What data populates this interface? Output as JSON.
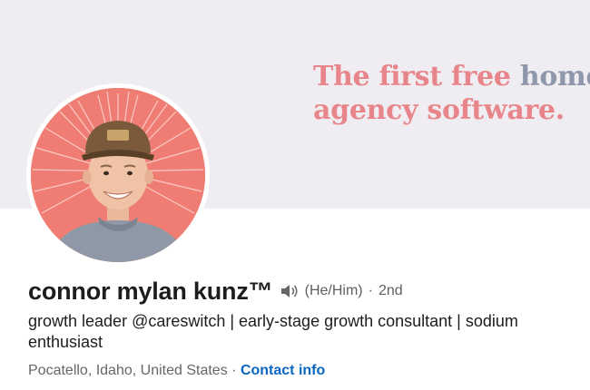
{
  "banner": {
    "line1_part1": "The first free",
    "line1_part2": "home c",
    "line2": "agency software."
  },
  "profile": {
    "name": "connor mylan kunz",
    "trademark": "™",
    "pronouns": "(He/Him)",
    "separator": "·",
    "degree": "2nd",
    "headline": "growth leader @careswitch | early-stage growth consultant | sodium enthusiast",
    "location": "Pocatello, Idaho, United States",
    "location_separator": "·",
    "contact_label": "Contact info"
  },
  "colors": {
    "banner_bg": "#efedf2",
    "banner_pink": "#e8858a",
    "banner_slate": "#8f97ab",
    "avatar_bg": "#ef7d73",
    "link": "#0a66c2",
    "name_text": "#1d1d1d",
    "secondary_text": "#666666"
  },
  "icons": {
    "name_pronunciation": "speaker-icon"
  }
}
